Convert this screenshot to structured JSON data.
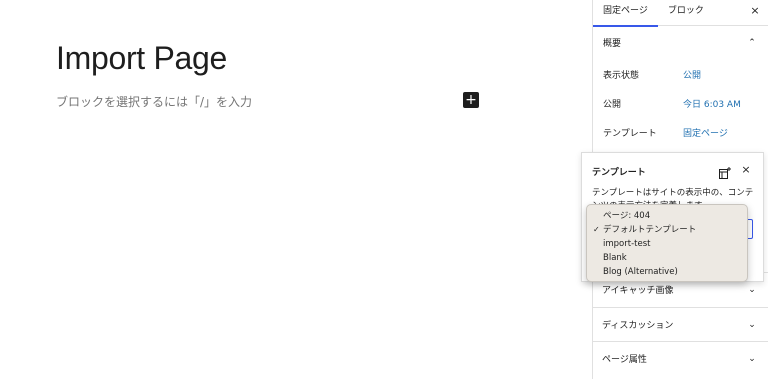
{
  "editor": {
    "page_title": "Import Page",
    "placeholder": "ブロックを選択するには「/」を入力",
    "add_block_symbol": "+"
  },
  "sidebar": {
    "tabs": [
      {
        "label": "固定ページ",
        "active": true
      },
      {
        "label": "ブロック",
        "active": false
      }
    ],
    "close_symbol": "×",
    "summary": {
      "title": "概要",
      "rows": [
        {
          "key": "表示状態",
          "value": "公開"
        },
        {
          "key": "公開",
          "value": "今日 6:03 AM"
        },
        {
          "key": "テンプレート",
          "value": "固定ページ"
        }
      ]
    },
    "sections": [
      {
        "label": "アイキャッチ画像"
      },
      {
        "label": "ディスカッション"
      },
      {
        "label": "ページ属性"
      }
    ]
  },
  "popover": {
    "title": "テンプレート",
    "description": "テンプレートはサイトの表示中の、コンテンツの表示方法を定義します。",
    "close_symbol": "×"
  },
  "dropdown": {
    "options": [
      {
        "label": "ページ: 404",
        "selected": false
      },
      {
        "label": "デフォルトテンプレート",
        "selected": true
      },
      {
        "label": "import-test",
        "selected": false
      },
      {
        "label": "Blank",
        "selected": false
      },
      {
        "label": "Blog (Alternative)",
        "selected": false
      }
    ],
    "check_symbol": "✓"
  },
  "colors": {
    "accent": "#3858e9",
    "link": "#2271b1",
    "dropdown_bg": "#ede9e3"
  }
}
